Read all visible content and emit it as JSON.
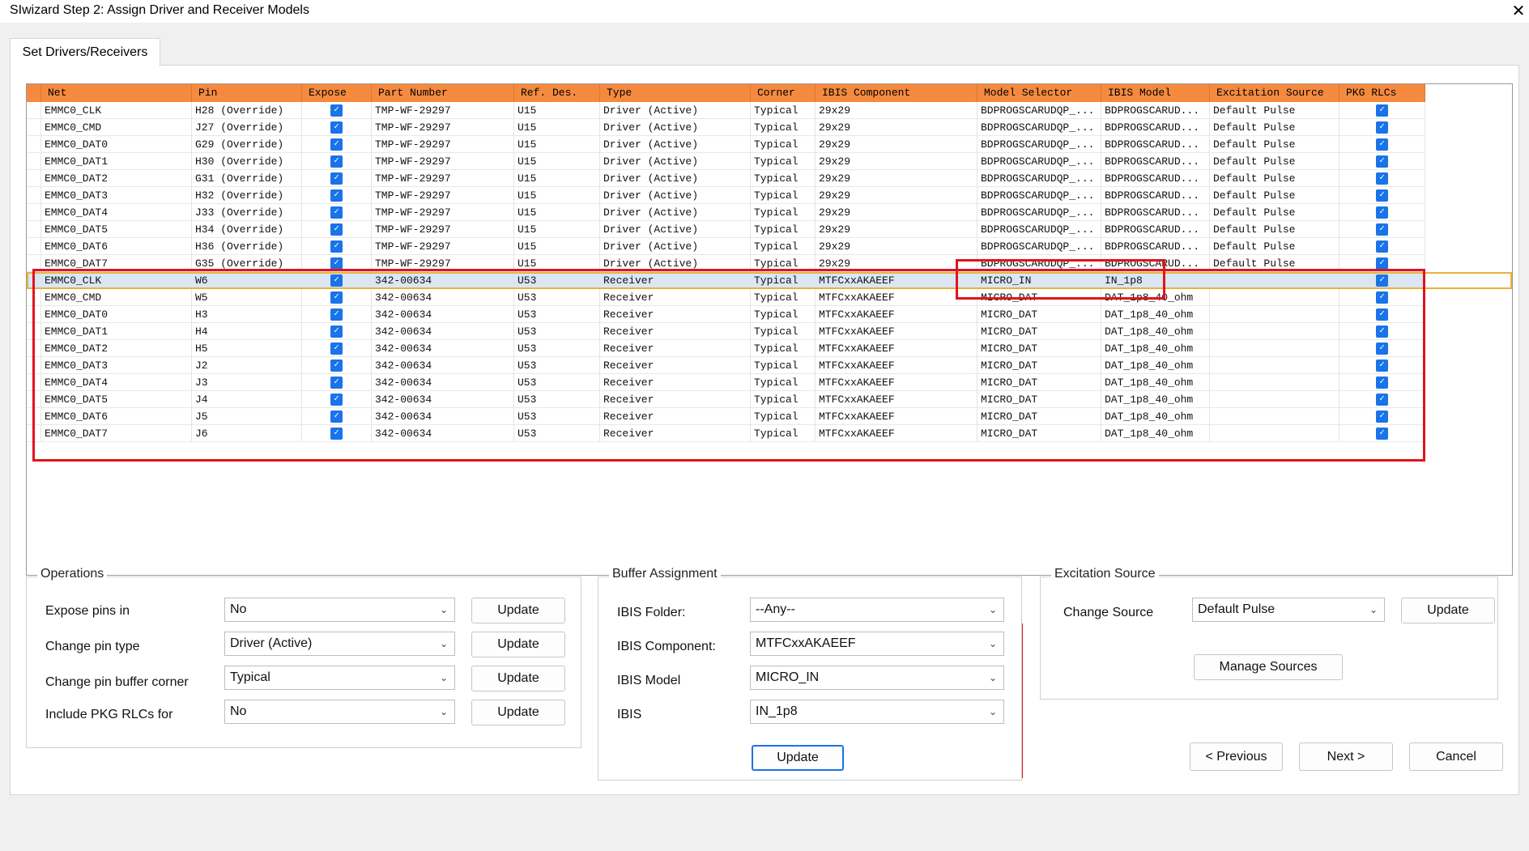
{
  "window": {
    "title": "SIwizard Step 2: Assign Driver and Receiver Models",
    "close_glyph": "✕"
  },
  "tab": {
    "label": "Set Drivers/Receivers"
  },
  "grid": {
    "columns": [
      "Net",
      "Pin",
      "Expose",
      "Part Number",
      "Ref. Des.",
      "Type",
      "Corner",
      "IBIS Component",
      "Model Selector",
      "IBIS Model",
      "Excitation Source",
      "PKG RLCs"
    ],
    "rows": [
      {
        "net": "EMMC0_CLK",
        "pin": "H28 (Override)",
        "part": "TMP-WF-29297",
        "ref": "U15",
        "type": "Driver (Active)",
        "corner": "Typical",
        "comp": "29x29",
        "selector": "BDPROGSCARUDQP_...",
        "model": "BDPROGSCARUD...",
        "exc": "Default Pulse"
      },
      {
        "net": "EMMC0_CMD",
        "pin": "J27 (Override)",
        "part": "TMP-WF-29297",
        "ref": "U15",
        "type": "Driver (Active)",
        "corner": "Typical",
        "comp": "29x29",
        "selector": "BDPROGSCARUDQP_...",
        "model": "BDPROGSCARUD...",
        "exc": "Default Pulse"
      },
      {
        "net": "EMMC0_DAT0",
        "pin": "G29 (Override)",
        "part": "TMP-WF-29297",
        "ref": "U15",
        "type": "Driver (Active)",
        "corner": "Typical",
        "comp": "29x29",
        "selector": "BDPROGSCARUDQP_...",
        "model": "BDPROGSCARUD...",
        "exc": "Default Pulse"
      },
      {
        "net": "EMMC0_DAT1",
        "pin": "H30 (Override)",
        "part": "TMP-WF-29297",
        "ref": "U15",
        "type": "Driver (Active)",
        "corner": "Typical",
        "comp": "29x29",
        "selector": "BDPROGSCARUDQP_...",
        "model": "BDPROGSCARUD...",
        "exc": "Default Pulse"
      },
      {
        "net": "EMMC0_DAT2",
        "pin": "G31 (Override)",
        "part": "TMP-WF-29297",
        "ref": "U15",
        "type": "Driver (Active)",
        "corner": "Typical",
        "comp": "29x29",
        "selector": "BDPROGSCARUDQP_...",
        "model": "BDPROGSCARUD...",
        "exc": "Default Pulse"
      },
      {
        "net": "EMMC0_DAT3",
        "pin": "H32 (Override)",
        "part": "TMP-WF-29297",
        "ref": "U15",
        "type": "Driver (Active)",
        "corner": "Typical",
        "comp": "29x29",
        "selector": "BDPROGSCARUDQP_...",
        "model": "BDPROGSCARUD...",
        "exc": "Default Pulse"
      },
      {
        "net": "EMMC0_DAT4",
        "pin": "J33 (Override)",
        "part": "TMP-WF-29297",
        "ref": "U15",
        "type": "Driver (Active)",
        "corner": "Typical",
        "comp": "29x29",
        "selector": "BDPROGSCARUDQP_...",
        "model": "BDPROGSCARUD...",
        "exc": "Default Pulse"
      },
      {
        "net": "EMMC0_DAT5",
        "pin": "H34 (Override)",
        "part": "TMP-WF-29297",
        "ref": "U15",
        "type": "Driver (Active)",
        "corner": "Typical",
        "comp": "29x29",
        "selector": "BDPROGSCARUDQP_...",
        "model": "BDPROGSCARUD...",
        "exc": "Default Pulse"
      },
      {
        "net": "EMMC0_DAT6",
        "pin": "H36 (Override)",
        "part": "TMP-WF-29297",
        "ref": "U15",
        "type": "Driver (Active)",
        "corner": "Typical",
        "comp": "29x29",
        "selector": "BDPROGSCARUDQP_...",
        "model": "BDPROGSCARUD...",
        "exc": "Default Pulse"
      },
      {
        "net": "EMMC0_DAT7",
        "pin": "G35 (Override)",
        "part": "TMP-WF-29297",
        "ref": "U15",
        "type": "Driver (Active)",
        "corner": "Typical",
        "comp": "29x29",
        "selector": "BDPROGSCARUDQP_...",
        "model": "BDPROGSCARUD...",
        "exc": "Default Pulse"
      },
      {
        "net": "EMMC0_CLK",
        "pin": "W6",
        "part": "342-00634",
        "ref": "U53",
        "type": "Receiver",
        "corner": "Typical",
        "comp": "MTFCxxAKAEEF",
        "selector": "MICRO_IN",
        "model": "IN_1p8",
        "exc": ""
      },
      {
        "net": "EMMC0_CMD",
        "pin": "W5",
        "part": "342-00634",
        "ref": "U53",
        "type": "Receiver",
        "corner": "Typical",
        "comp": "MTFCxxAKAEEF",
        "selector": "MICRO_DAT",
        "model": "DAT_1p8_40_ohm",
        "exc": ""
      },
      {
        "net": "EMMC0_DAT0",
        "pin": "H3",
        "part": "342-00634",
        "ref": "U53",
        "type": "Receiver",
        "corner": "Typical",
        "comp": "MTFCxxAKAEEF",
        "selector": "MICRO_DAT",
        "model": "DAT_1p8_40_ohm",
        "exc": ""
      },
      {
        "net": "EMMC0_DAT1",
        "pin": "H4",
        "part": "342-00634",
        "ref": "U53",
        "type": "Receiver",
        "corner": "Typical",
        "comp": "MTFCxxAKAEEF",
        "selector": "MICRO_DAT",
        "model": "DAT_1p8_40_ohm",
        "exc": ""
      },
      {
        "net": "EMMC0_DAT2",
        "pin": "H5",
        "part": "342-00634",
        "ref": "U53",
        "type": "Receiver",
        "corner": "Typical",
        "comp": "MTFCxxAKAEEF",
        "selector": "MICRO_DAT",
        "model": "DAT_1p8_40_ohm",
        "exc": ""
      },
      {
        "net": "EMMC0_DAT3",
        "pin": "J2",
        "part": "342-00634",
        "ref": "U53",
        "type": "Receiver",
        "corner": "Typical",
        "comp": "MTFCxxAKAEEF",
        "selector": "MICRO_DAT",
        "model": "DAT_1p8_40_ohm",
        "exc": ""
      },
      {
        "net": "EMMC0_DAT4",
        "pin": "J3",
        "part": "342-00634",
        "ref": "U53",
        "type": "Receiver",
        "corner": "Typical",
        "comp": "MTFCxxAKAEEF",
        "selector": "MICRO_DAT",
        "model": "DAT_1p8_40_ohm",
        "exc": ""
      },
      {
        "net": "EMMC0_DAT5",
        "pin": "J4",
        "part": "342-00634",
        "ref": "U53",
        "type": "Receiver",
        "corner": "Typical",
        "comp": "MTFCxxAKAEEF",
        "selector": "MICRO_DAT",
        "model": "DAT_1p8_40_ohm",
        "exc": ""
      },
      {
        "net": "EMMC0_DAT6",
        "pin": "J5",
        "part": "342-00634",
        "ref": "U53",
        "type": "Receiver",
        "corner": "Typical",
        "comp": "MTFCxxAKAEEF",
        "selector": "MICRO_DAT",
        "model": "DAT_1p8_40_ohm",
        "exc": ""
      },
      {
        "net": "EMMC0_DAT7",
        "pin": "J6",
        "part": "342-00634",
        "ref": "U53",
        "type": "Receiver",
        "corner": "Typical",
        "comp": "MTFCxxAKAEEF",
        "selector": "MICRO_DAT",
        "model": "DAT_1p8_40_ohm",
        "exc": ""
      }
    ],
    "check_glyph": "✓",
    "selected_row_index": 10
  },
  "operations": {
    "title": "Operations",
    "rows": [
      {
        "label": "Expose pins in",
        "value": "No",
        "button": "Update"
      },
      {
        "label": "Change pin type",
        "value": "Driver (Active)",
        "button": "Update"
      },
      {
        "label": "Change pin buffer corner",
        "value": "Typical",
        "button": "Update"
      },
      {
        "label": "Include PKG RLCs for",
        "value": "No",
        "button": "Update"
      }
    ]
  },
  "buffer": {
    "title": "Buffer Assignment",
    "rows": [
      {
        "label": "IBIS Folder:",
        "value": "--Any--"
      },
      {
        "label": "IBIS Component:",
        "value": "MTFCxxAKAEEF"
      },
      {
        "label": "IBIS Model",
        "value": "MICRO_IN"
      },
      {
        "label": "IBIS",
        "value": "IN_1p8"
      }
    ],
    "update_label": "Update"
  },
  "excitation": {
    "title": "Excitation Source",
    "change_label": "Change Source",
    "value": "Default Pulse",
    "update_label": "Update",
    "manage_label": "Manage Sources"
  },
  "nav": {
    "previous": "< Previous",
    "next": "Next >",
    "cancel": "Cancel"
  },
  "colors": {
    "header": "#f58a3f",
    "highlight": "#e0141e",
    "check": "#1a73e8",
    "selection": "#dbe6f5",
    "selection_border": "#e8b23a"
  },
  "icons": {
    "dropdown": "⌄"
  }
}
